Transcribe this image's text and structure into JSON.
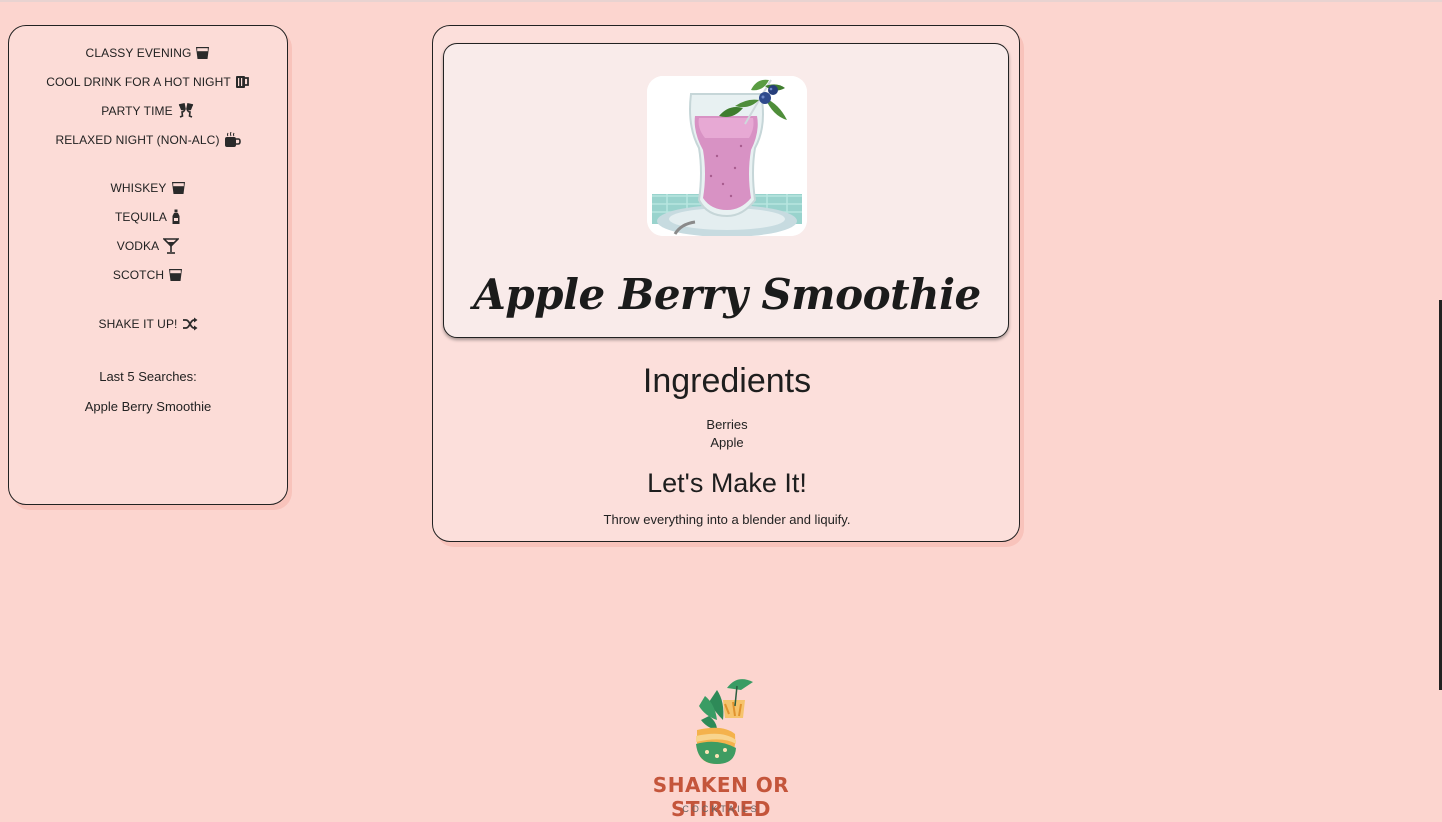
{
  "sidebar": {
    "moods": [
      {
        "label": "CLASSY EVENING",
        "icon": "whiskey-glass-icon"
      },
      {
        "label": "COOL DRINK FOR A HOT NIGHT",
        "icon": "beer-mug-icon"
      },
      {
        "label": "PARTY TIME",
        "icon": "champagne-glasses-icon"
      },
      {
        "label": "RELAXED NIGHT (NON-ALC)",
        "icon": "coffee-mug-icon"
      }
    ],
    "spirits": [
      {
        "label": "WHISKEY",
        "icon": "whiskey-glass-icon"
      },
      {
        "label": "TEQUILA",
        "icon": "bottle-icon"
      },
      {
        "label": "VODKA",
        "icon": "martini-glass-icon"
      },
      {
        "label": "SCOTCH",
        "icon": "whiskey-glass-icon"
      }
    ],
    "shake": {
      "label": "SHAKE IT UP!",
      "icon": "shuffle-icon"
    },
    "last_searches_title": "Last 5 Searches:",
    "last_searches": [
      "Apple Berry Smoothie"
    ]
  },
  "drink": {
    "name": "Apple Berry Smoothie",
    "ingredients_title": "Ingredients",
    "ingredients": [
      "Berries",
      "Apple"
    ],
    "instructions_title": "Let's Make It!",
    "instructions": "Throw everything into a blender and liquify."
  },
  "footer": {
    "brand": "SHAKEN OR STIRRED",
    "tagline": "COCKTAILS"
  },
  "colors": {
    "background": "#fcd5cf",
    "card": "#fcdfdb",
    "hero": "#f9ebea",
    "brand": "#c4553b"
  }
}
